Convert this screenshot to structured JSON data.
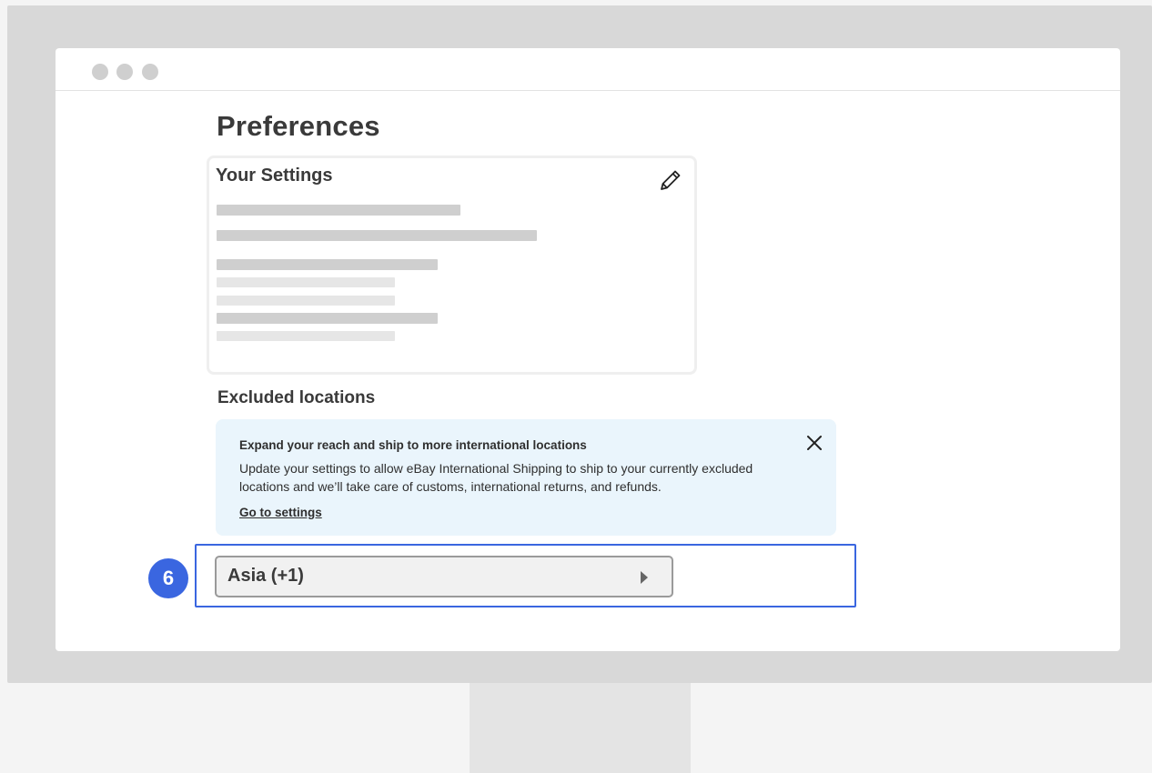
{
  "page": {
    "title": "Preferences"
  },
  "settings_card": {
    "title": "Your Settings",
    "edit_icon": "pencil-icon"
  },
  "excluded_locations": {
    "title": "Excluded locations",
    "banner": {
      "title": "Expand your reach and ship to more international locations",
      "body": "Update your settings to allow eBay International Shipping to ship to your currently excluded locations and we’ll take care of customs, international returns, and refunds.",
      "link": "Go to settings",
      "close_icon": "close-icon"
    },
    "region_button": {
      "label": "Asia (+1)",
      "icon": "caret-right-icon"
    }
  },
  "annotation": {
    "step_number": "6",
    "color": "#3a66e0"
  },
  "colors": {
    "banner_bg": "#eaf5fc",
    "placeholder_bar": "#cfcfcf"
  }
}
